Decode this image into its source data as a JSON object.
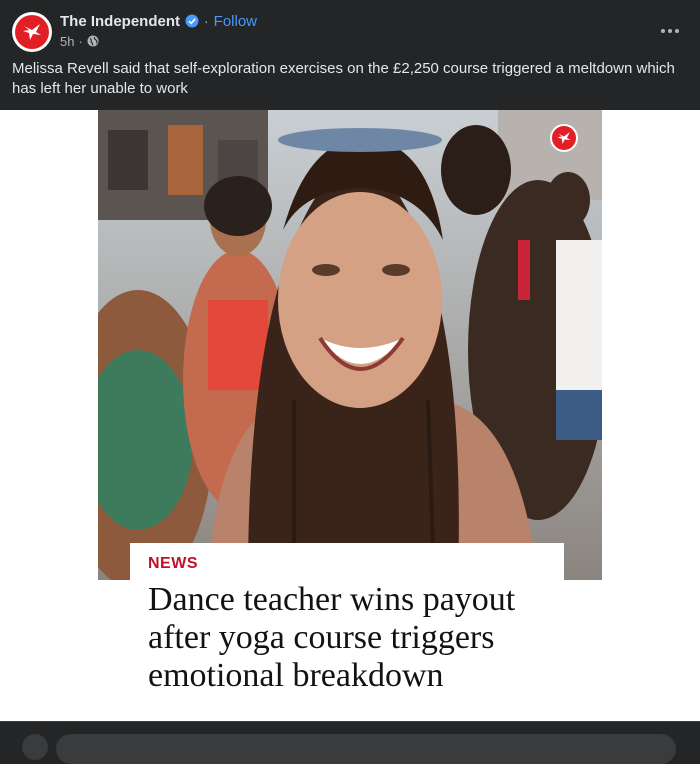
{
  "post": {
    "page_name": "The Independent",
    "verified_icon": "verified-badge-icon",
    "separator": "·",
    "follow_label": "Follow",
    "time": "5h",
    "audience_icon": "globe-icon",
    "more_icon": "more-horizontal-icon",
    "caption": "Melissa Revell said that self-exploration exercises on the £2,250 course triggered a meltdown which has left her unable to work"
  },
  "link_card": {
    "section": "NEWS",
    "headline": "Dance teacher wins payout after yoga course triggers emotional breakdown",
    "logo_icon": "eagle-logo-icon"
  },
  "colors": {
    "background": "#242526",
    "text_primary": "#e4e6eb",
    "text_secondary": "#b0b3b8",
    "link_blue": "#4599ff",
    "brand_red": "#e21f26",
    "news_red": "#c3102a"
  }
}
